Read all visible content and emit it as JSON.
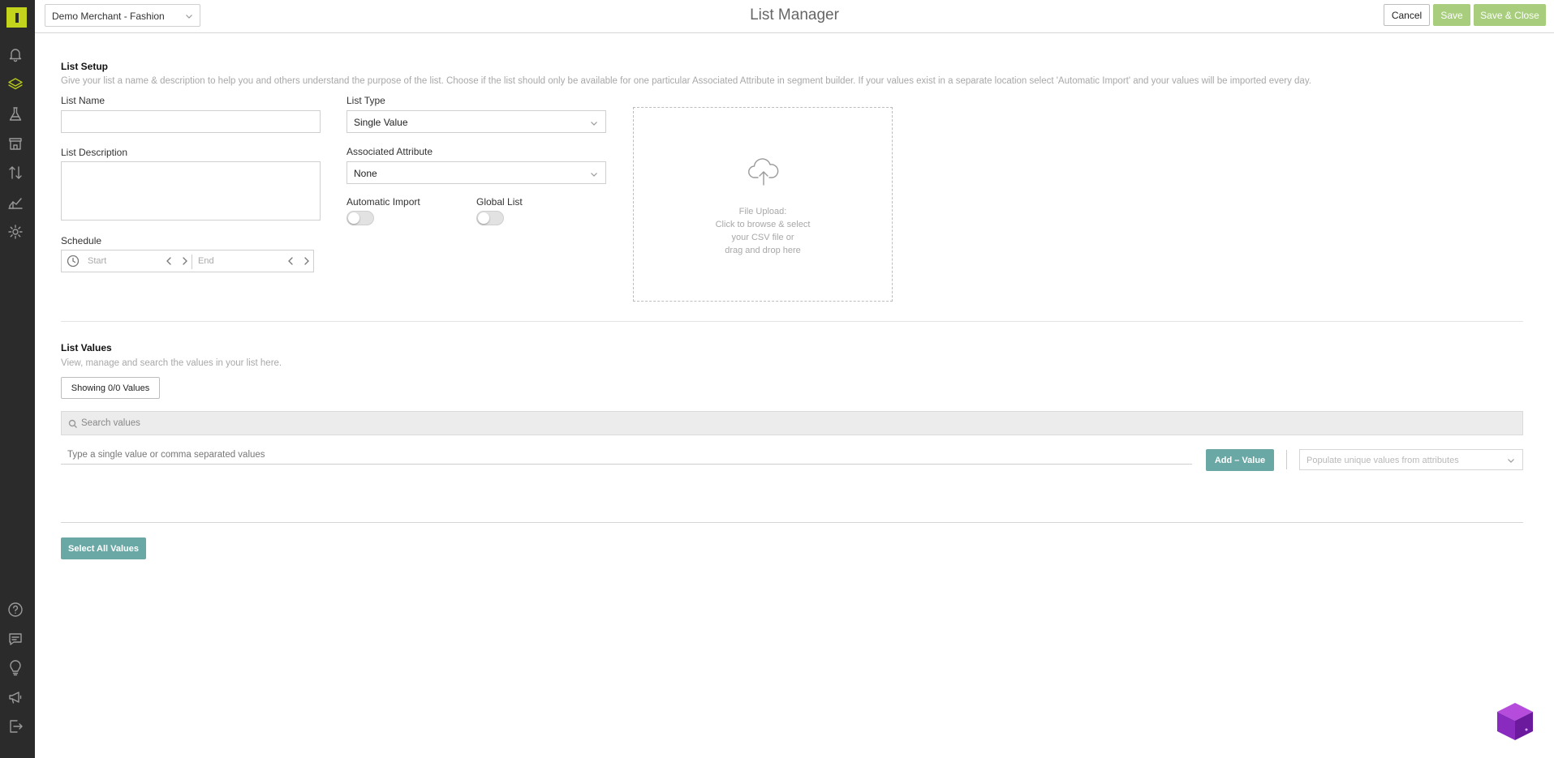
{
  "header": {
    "merchant": "Demo Merchant - Fashion",
    "title": "List Manager",
    "cancel_label": "Cancel",
    "save_label": "Save",
    "save_close_label": "Save & Close"
  },
  "sidebar": {
    "top_items": [
      "notifications",
      "lists",
      "experiments",
      "catalog",
      "import-export",
      "analytics",
      "settings"
    ],
    "bottom_items": [
      "help",
      "feedback",
      "ideas",
      "announcements",
      "logout"
    ],
    "accent_color": "#c4d41c"
  },
  "list_setup": {
    "title": "List Setup",
    "description": "Give your list a name & description to help you and others understand the purpose of the list. Choose if the list should only be available for one particular Associated Attribute in segment builder. If your values exist in a separate location select 'Automatic Import' and your values will be imported every day.",
    "list_name_label": "List Name",
    "list_name_value": "",
    "list_description_label": "List Description",
    "list_description_value": "",
    "schedule_label": "Schedule",
    "schedule_start": "Start",
    "schedule_end": "End",
    "list_type_label": "List Type",
    "list_type_value": "Single Value",
    "associated_attribute_label": "Associated Attribute",
    "associated_attribute_value": "None",
    "automatic_import_label": "Automatic Import",
    "automatic_import_on": false,
    "global_list_label": "Global List",
    "global_list_on": false,
    "upload_lines": [
      "File Upload:",
      "Click to browse & select",
      "your CSV file or",
      "drag and drop here"
    ]
  },
  "list_values": {
    "title": "List Values",
    "description": "View, manage and search the values in your list here.",
    "showing_label": "Showing 0/0 Values",
    "search_placeholder": "Search values",
    "value_input_placeholder": "Type a single value or comma separated values",
    "add_value_label": "Add – Value",
    "populate_placeholder": "Populate unique values from attributes",
    "select_all_label": "Select All Values",
    "button_color": "#6aa8a5"
  }
}
